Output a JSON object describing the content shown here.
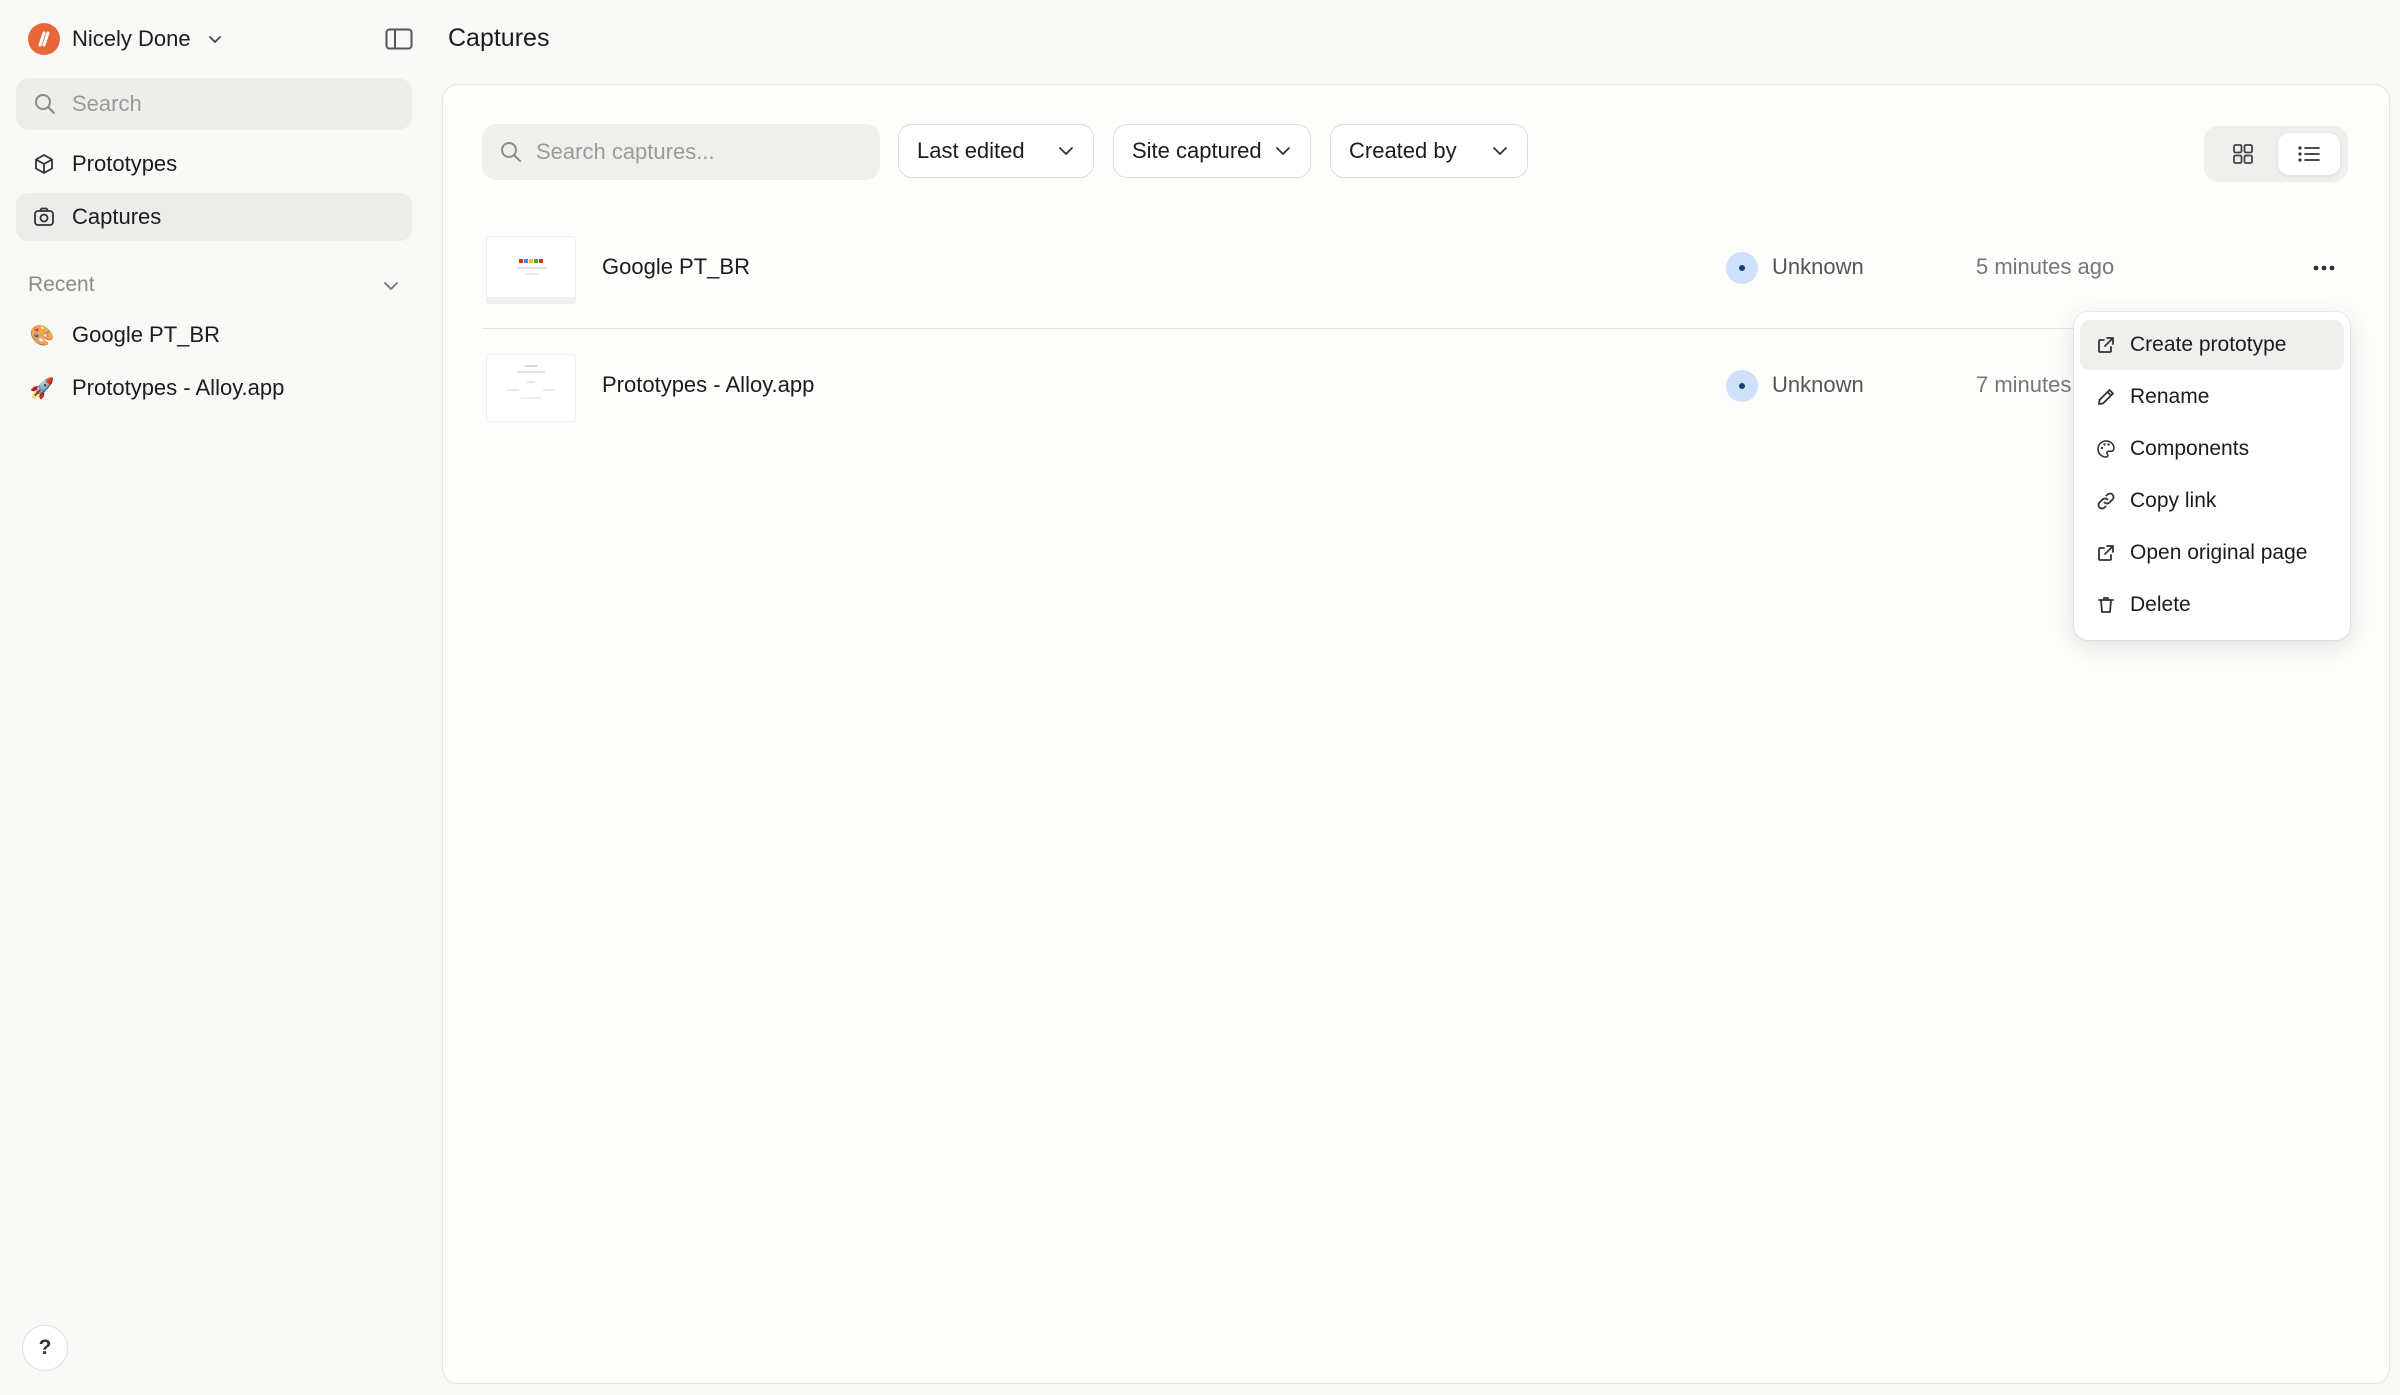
{
  "workspace": {
    "name": "Nicely Done"
  },
  "sidebar": {
    "search_placeholder": "Search",
    "nav": [
      {
        "label": "Prototypes",
        "icon": "cube-icon"
      },
      {
        "label": "Captures",
        "icon": "camera-icon",
        "active": true
      }
    ],
    "recent_label": "Recent",
    "recent": [
      {
        "emoji": "🎨",
        "label": "Google PT_BR"
      },
      {
        "emoji": "🚀",
        "label": "Prototypes - Alloy.app"
      }
    ],
    "help_label": "?"
  },
  "page": {
    "title": "Captures"
  },
  "toolbar": {
    "search_placeholder": "Search captures...",
    "filters": [
      "Last edited",
      "Site captured",
      "Created by"
    ]
  },
  "captures": [
    {
      "name": "Google PT_BR",
      "owner": "Unknown",
      "time": "5 minutes ago"
    },
    {
      "name": "Prototypes - Alloy.app",
      "owner": "Unknown",
      "time": "7 minutes ago"
    }
  ],
  "context_menu": {
    "items": [
      {
        "label": "Create prototype",
        "icon": "external-link-icon"
      },
      {
        "label": "Rename",
        "icon": "pencil-icon"
      },
      {
        "label": "Components",
        "icon": "palette-icon"
      },
      {
        "label": "Copy link",
        "icon": "link-icon"
      },
      {
        "label": "Open original page",
        "icon": "external-link-icon"
      },
      {
        "label": "Delete",
        "icon": "trash-icon"
      }
    ]
  },
  "colors": {
    "brand": "#e8673a",
    "avatar": "#cfe0fb",
    "background": "#f8f8f7"
  }
}
